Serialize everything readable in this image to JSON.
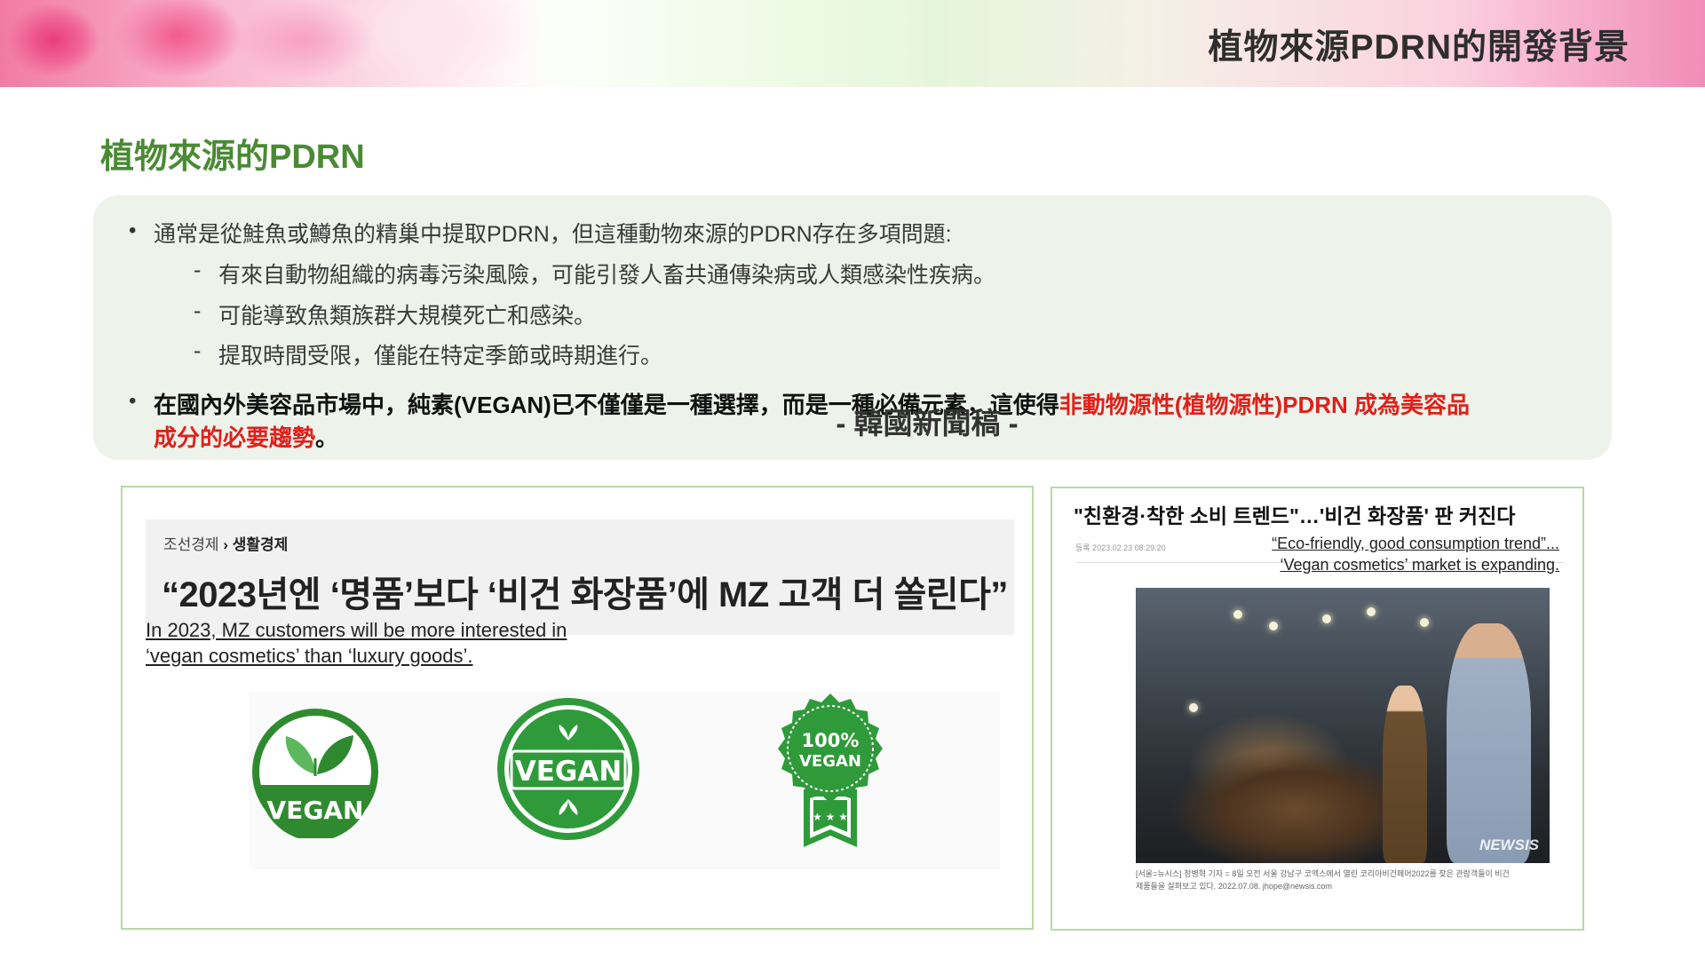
{
  "header": {
    "title": "植物來源PDRN的開發背景"
  },
  "section": {
    "title": "植物來源的PDRN"
  },
  "bullets": {
    "b1": "通常是從鮭魚或鱒魚的精巢中提取PDRN，但這種動物來源的PDRN存在多項問題:",
    "sub1": "有來自動物組織的病毒污染風險，可能引發人畜共通傳染病或人類感染性疾病。",
    "sub2": "可能導致魚類族群大規模死亡和感染。",
    "sub3": "提取時間受限，僅能在特定季節或時期進行。",
    "b2_black1": "在國內外美容品市場中，純素(VEGAN)已不僅僅是一種選擇，而是一種必備元素，這使得",
    "b2_red1": "非動物源性(植物源性)PDRN 成為美容品",
    "b2_red2": "成分的必要趨勢",
    "b2_end": "。"
  },
  "left_article": {
    "crumb_a": "조선경제",
    "crumb_sep": "›",
    "crumb_b": "생활경제",
    "title": "“2023년엔 ‘명품’보다 ‘비건 화장품’에 MZ 고객 더 쏠린다”",
    "eng1": "In 2023, MZ customers will be more interested in",
    "eng2": "‘vegan cosmetics’ than ‘luxury goods’.",
    "badge1": "VEGAN",
    "badge2": "VEGAN",
    "badge3a": "100%",
    "badge3b": "VEGAN"
  },
  "right_article": {
    "title": "\"친환경·착한 소비 트렌드\"…'비건 화장품' 판 커진다",
    "date": "등록 2023.02.23 08:29:20",
    "eng1": "“Eco-friendly, good consumption trend”...",
    "eng2": "‘Vegan cosmetics’ market is expanding.",
    "watermark": "NEWSIS",
    "caption1": "[서울=뉴시스] 정병혁 기자 = 8일 오전 서울 강남구 코엑스에서 열린 코리아비건페어2022를 찾은 관람객들이 비건",
    "caption2": "제품들을 살펴보고 있다. 2022.07.08. jhope@newsis.com"
  },
  "source_note": "- 韓國新聞稿 -",
  "colors": {
    "green_title": "#4a8a34",
    "red_emphasis": "#e0201b",
    "badge_green": "#2f8a2f",
    "panel_border": "#b9d7a6"
  }
}
